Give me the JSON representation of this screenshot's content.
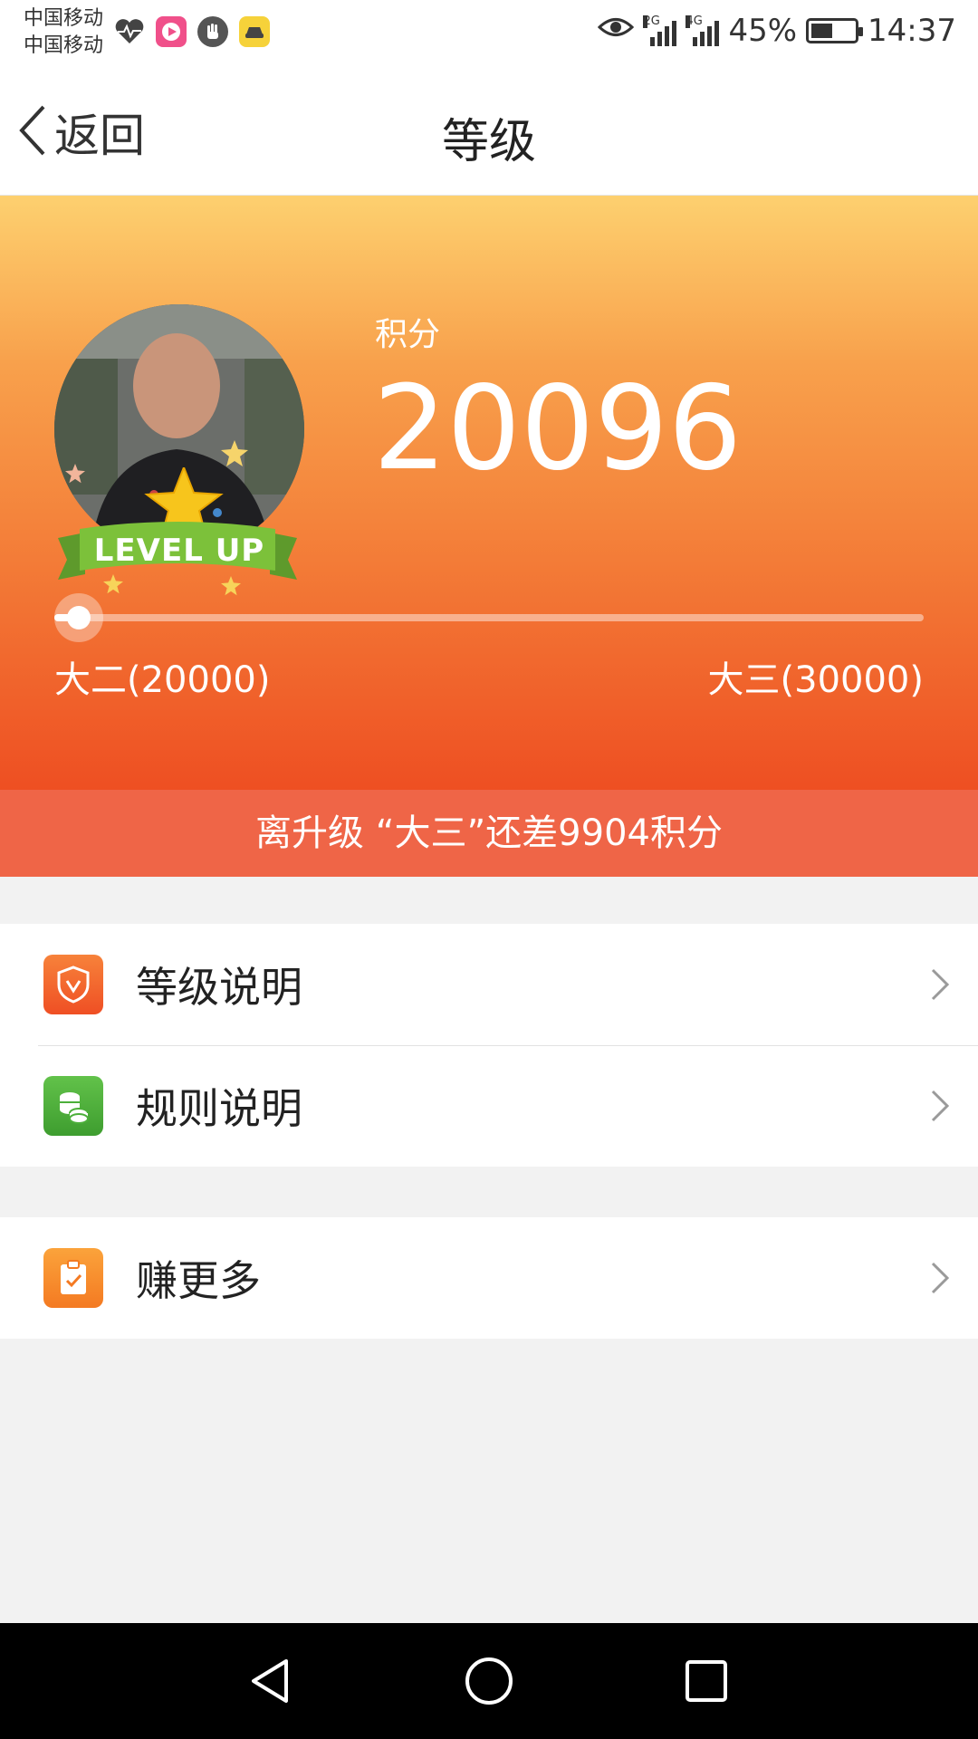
{
  "status_bar": {
    "carrier_1": "中国移动",
    "carrier_2": "中国移动",
    "network_1": "2G",
    "network_2": "4G",
    "battery": "45%",
    "time": "14:37",
    "app_icons": [
      "heart-pulse-icon",
      "video-app-icon",
      "hand-app-icon",
      "car-app-icon"
    ]
  },
  "nav": {
    "back_label": "返回",
    "title": "等级"
  },
  "hero": {
    "points_label": "积分",
    "points_value": "20096",
    "badge_text": "LEVEL UP",
    "current_level": "大二(20000)",
    "next_level": "大三(30000)",
    "progress": 0.0096,
    "gradient_top": "#fdd06f",
    "gradient_bottom": "#ee4f22"
  },
  "upgrade_message": "离升级 “大三”还差9904积分",
  "menu": {
    "group1": [
      {
        "label": "等级说明",
        "icon": "shield-icon",
        "icon_color": "#f05a2a"
      },
      {
        "label": "规则说明",
        "icon": "coins-icon",
        "icon_color": "#4caf3a"
      }
    ],
    "group2": [
      {
        "label": "赚更多",
        "icon": "clipboard-check-icon",
        "icon_color": "#f7832a"
      }
    ]
  },
  "system_nav": [
    "back-icon",
    "home-icon",
    "recents-icon"
  ]
}
